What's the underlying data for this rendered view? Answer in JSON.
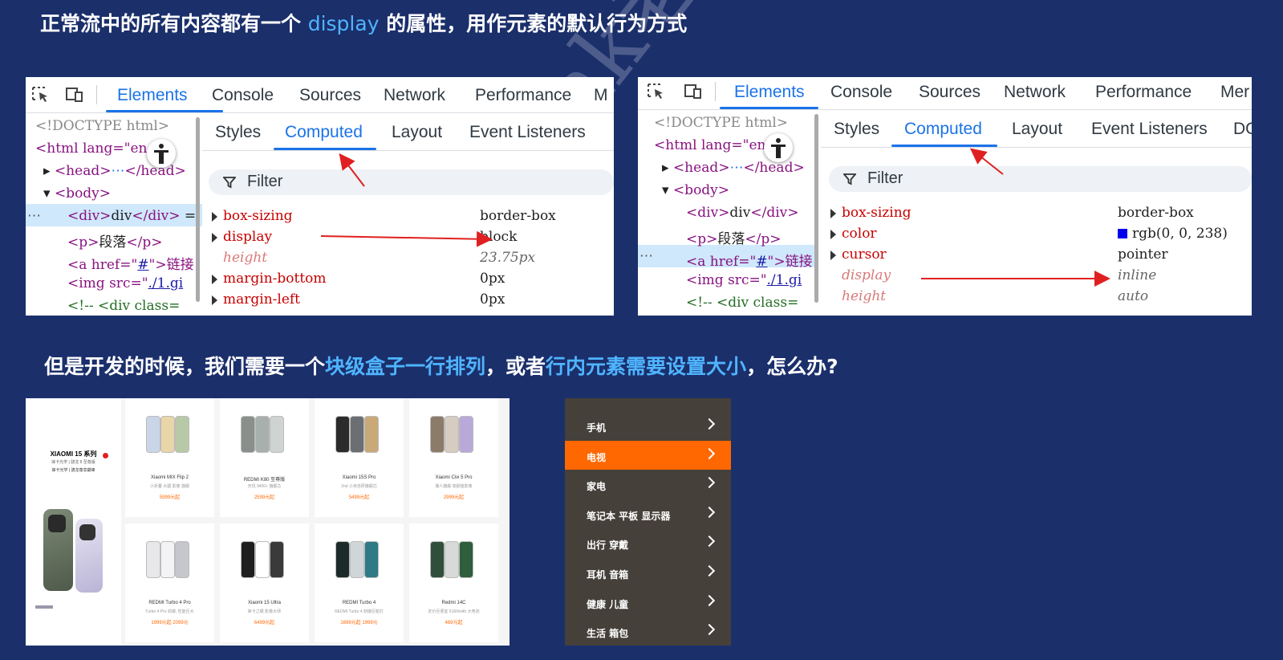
{
  "heading1": {
    "pre": "正常流中的所有内容都有一个 ",
    "keyword": "display",
    "post": " 的属性，用作元素的默认行为方式"
  },
  "heading2": {
    "p1": "但是开发的时候，我们需要一个",
    "h1": "块级盒子一行排列",
    "p2": "，或者",
    "h2": "行内元素需要设置大小",
    "p3": "，怎么办?"
  },
  "watermark": "pink老师",
  "devtools": {
    "tabs": [
      "Elements",
      "Console",
      "Sources",
      "Network",
      "Performance"
    ],
    "left_cut_tab": "M",
    "right_cut_tab": "Mer",
    "subtabs": [
      "Styles",
      "Computed",
      "Layout",
      "Event Listeners"
    ],
    "right_cut_subtab": "DO",
    "filter": "Filter",
    "dom": {
      "doctype": "<!DOCTYPE html>",
      "html_open": "<html lang=\"en",
      "head": "<head>",
      "head_close": "</head>",
      "ellipsis": "⋯",
      "body": "<body>",
      "div_open": "<div>",
      "div_text": "div",
      "div_close": "</div>",
      "div_eq": " =",
      "p_open": "<p>",
      "p_text": "段落",
      "p_close": "</p>",
      "a_open": "<a href=\"",
      "a_href": "#",
      "a_close": "\">链接",
      "img_open": "<img src=\"",
      "img_src": "./1.gi",
      "comment": "<!-- <div class="
    },
    "left_props": [
      {
        "name": "box-sizing",
        "value": "border-box",
        "inherited": false
      },
      {
        "name": "display",
        "value": "block",
        "inherited": false
      },
      {
        "name": "height",
        "value": "23.75px",
        "inherited": true
      },
      {
        "name": "margin-bottom",
        "value": "0px",
        "inherited": false
      },
      {
        "name": "margin-left",
        "value": "0px",
        "inherited": false
      }
    ],
    "right_props": [
      {
        "name": "box-sizing",
        "value": "border-box",
        "inherited": false
      },
      {
        "name": "color",
        "value": "rgb(0, 0, 238)",
        "inherited": false,
        "swatch": "#0000ee"
      },
      {
        "name": "cursor",
        "value": "pointer",
        "inherited": false
      },
      {
        "name": "display",
        "value": "inline",
        "inherited": true
      },
      {
        "name": "height",
        "value": "auto",
        "inherited": true
      }
    ],
    "right_partial_value": "0"
  },
  "products": [
    {
      "name": "Xiaomi MIX Flip 2",
      "desc": "小折叠 大疆 影像 旗舰",
      "price": "5999元起"
    },
    {
      "name": "REDMI K80 至尊版",
      "desc": "天玑 9400+ 旗舰芯",
      "price": "2599元起"
    },
    {
      "name": "Xiaomi 15S Pro",
      "desc": "2nd 小米自研旗舰芯",
      "price": "5499元起"
    },
    {
      "name": "Xiaomi Civi 5 Pro",
      "desc": "潮人旗舰 高颜值影像",
      "price": "2999元起"
    },
    {
      "name": "REDMI Turbo 4 Pro",
      "desc": "Turbo 4 Pro 劲爆, 性能巨大",
      "price": "1999元起 2099元"
    },
    {
      "name": "Xiaomi 15 Ultra",
      "desc": "徕卡之眼 影像大师",
      "price": "6499元起"
    },
    {
      "name": "REDMI Turbo 4",
      "desc": "REDMI Turbo 4 劲爆巨能打",
      "price": "1699元起 1999元"
    },
    {
      "name": "Redmi 14C",
      "desc": "定价巨便宜 5160mAh 大电池",
      "price": "469元起"
    }
  ],
  "promo": {
    "brand": "XIAOMI 15 系列",
    "sub": "徕卡光学 | 骁龙 8 至尊版",
    "line2": "徕卡光学 | 骁龙尊享巅峰"
  },
  "menu": [
    {
      "label": "手机",
      "active": false
    },
    {
      "label": "电视",
      "active": true
    },
    {
      "label": "家电",
      "active": false
    },
    {
      "label": "笔记本 平板 显示器",
      "active": false
    },
    {
      "label": "出行 穿戴",
      "active": false
    },
    {
      "label": "耳机 音箱",
      "active": false
    },
    {
      "label": "健康 儿童",
      "active": false
    },
    {
      "label": "生活 箱包",
      "active": false
    }
  ],
  "colors": {
    "background": "#1b2f6b",
    "highlight": "#4fb4ff",
    "devtools_accent": "#1a73e8",
    "arrow": "#e02020",
    "menu_bg": "#46403a",
    "menu_active": "#ff6700"
  }
}
